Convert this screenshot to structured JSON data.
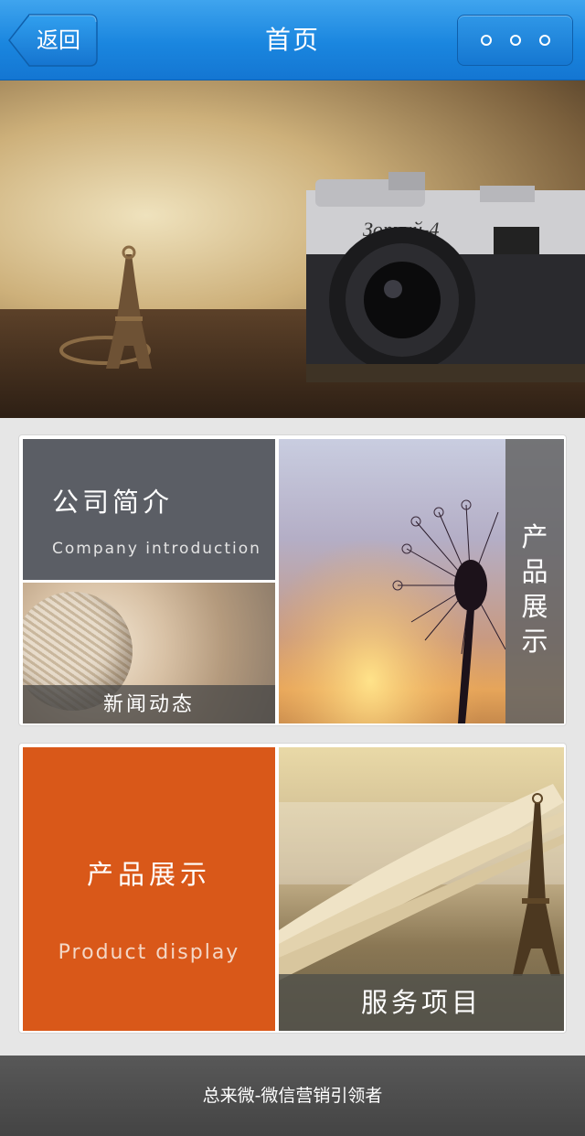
{
  "header": {
    "back_label": "返回",
    "title": "首页",
    "more_icon": "more-dots-icon",
    "color": "#1a86df"
  },
  "banner": {
    "image": "camera-eiffel-photo",
    "camera_text": "Зоркий-4"
  },
  "tiles": {
    "company": {
      "title": "公司简介",
      "subtitle": "Company introduction",
      "color": "#5b5e65"
    },
    "news": {
      "label": "新闻动态"
    },
    "products_side": {
      "label": "产品展示"
    },
    "products": {
      "title": "产品展示",
      "subtitle": "Product display",
      "color": "#d95819"
    },
    "services": {
      "label": "服务项目"
    }
  },
  "footer": {
    "text": "总来微-微信营销引领者"
  }
}
